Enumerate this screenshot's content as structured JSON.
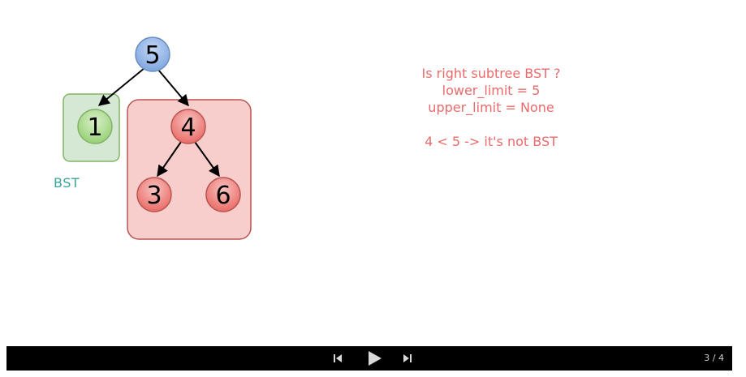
{
  "tree": {
    "root": {
      "value": "5",
      "color": "#7ea6e0"
    },
    "left": {
      "value": "1",
      "color": "#97d077"
    },
    "right": {
      "value": "4",
      "color": "#ea6b66"
    },
    "right_left": {
      "value": "3",
      "color": "#ea6b66"
    },
    "right_right": {
      "value": "6",
      "color": "#ea6b66"
    }
  },
  "annotations": {
    "bst_label": "BST",
    "bst_label_color": "#3aa59a"
  },
  "explanation": {
    "line1": "Is right subtree BST ?",
    "line2": "lower_limit = 5",
    "line3": "upper_limit = None",
    "line4": "4 < 5 -> it's not BST",
    "color": "#ea6b6b"
  },
  "player": {
    "page_counter": "3 / 4",
    "prev_icon": "skip-back-icon",
    "play_icon": "play-icon",
    "next_icon": "skip-forward-icon"
  }
}
